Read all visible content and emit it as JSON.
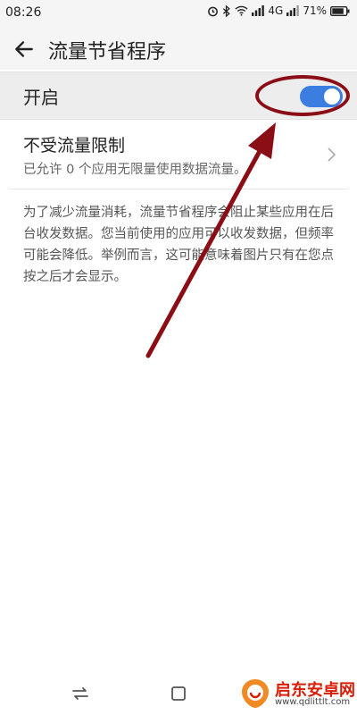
{
  "status_bar": {
    "time": "08:26",
    "network": "4G",
    "battery": "71%"
  },
  "header": {
    "title": "流量节省程序"
  },
  "toggle": {
    "label": "开启",
    "state": "on",
    "accent_color": "#3b7de0"
  },
  "unrestricted": {
    "title": "不受流量限制",
    "subtitle": "已允许 0 个应用无限量使用数据流量。"
  },
  "description": "为了减少流量消耗，流量节省程序会阻止某些应用在后台收发数据。您当前使用的应用可以收发数据，但频率可能会降低。举例而言，这可能意味着图片只有在您点按之后才会显示。",
  "annotation": {
    "color": "#8b0d15"
  },
  "watermark": {
    "title": "启东安卓网",
    "url": "www.qdlittlt.com"
  }
}
